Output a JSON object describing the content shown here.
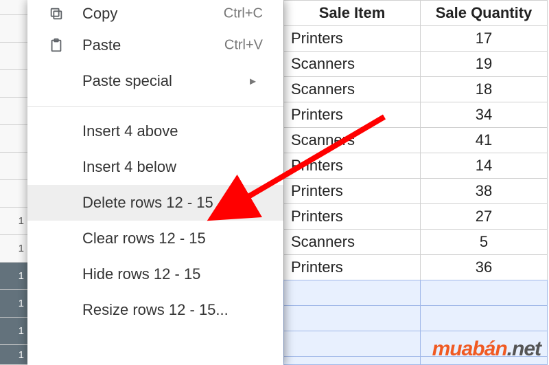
{
  "chart_data": {
    "type": "table",
    "columns": [
      "Sale Item",
      "Sale Quantity"
    ],
    "rows": [
      [
        "Printers",
        17
      ],
      [
        "Scanners",
        19
      ],
      [
        "Scanners",
        18
      ],
      [
        "Printers",
        34
      ],
      [
        "Scanners",
        41
      ],
      [
        "Printers",
        14
      ],
      [
        "Printers",
        38
      ],
      [
        "Printers",
        27
      ],
      [
        "Scanners",
        5
      ],
      [
        "Printers",
        36
      ]
    ]
  },
  "menu": {
    "copy": {
      "label": "Copy",
      "shortcut": "Ctrl+C"
    },
    "paste": {
      "label": "Paste",
      "shortcut": "Ctrl+V"
    },
    "paste_special": {
      "label": "Paste special"
    },
    "insert_above": {
      "label": "Insert 4 above"
    },
    "insert_below": {
      "label": "Insert 4 below"
    },
    "delete_rows": {
      "label": "Delete rows 12 - 15"
    },
    "clear_rows": {
      "label": "Clear rows 12 - 15"
    },
    "hide_rows": {
      "label": "Hide rows 12 - 15"
    },
    "resize_rows": {
      "label": "Resize rows 12 - 15..."
    }
  },
  "rowheaders": {
    "r10": "1",
    "r11": "1",
    "r12": "1",
    "r13": "1",
    "r14": "1",
    "r15": "1"
  },
  "watermark": {
    "main": "muabán",
    "net": ".net"
  }
}
